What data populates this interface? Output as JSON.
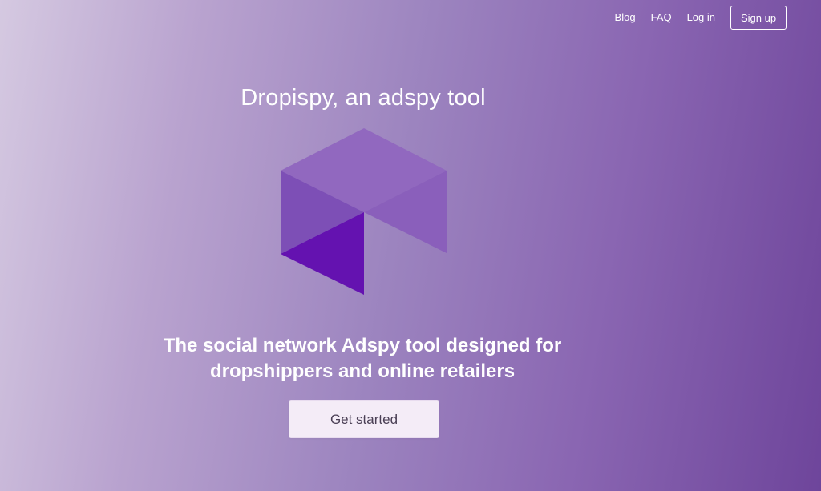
{
  "nav": {
    "links": [
      {
        "label": "Blog"
      },
      {
        "label": "FAQ"
      },
      {
        "label": "Log in"
      }
    ],
    "signup_label": "Sign up"
  },
  "hero": {
    "title": "Dropispy, an adspy tool",
    "tagline_line1": "The social network Adspy tool designed for",
    "tagline_line2": "dropshippers and online retailers",
    "cta_label": "Get started"
  },
  "logo": {
    "icon": "dropispy-logo-icon",
    "colors": {
      "top": "#9168bf",
      "right": "#8a5fbb",
      "left": "#7d4fb6",
      "bottom": "#6412b0"
    }
  },
  "colors": {
    "gradient_start": "#d5c9e1",
    "gradient_end": "#6e459b",
    "cta_background": "#f4ecf7",
    "cta_text": "#4a3f55"
  }
}
